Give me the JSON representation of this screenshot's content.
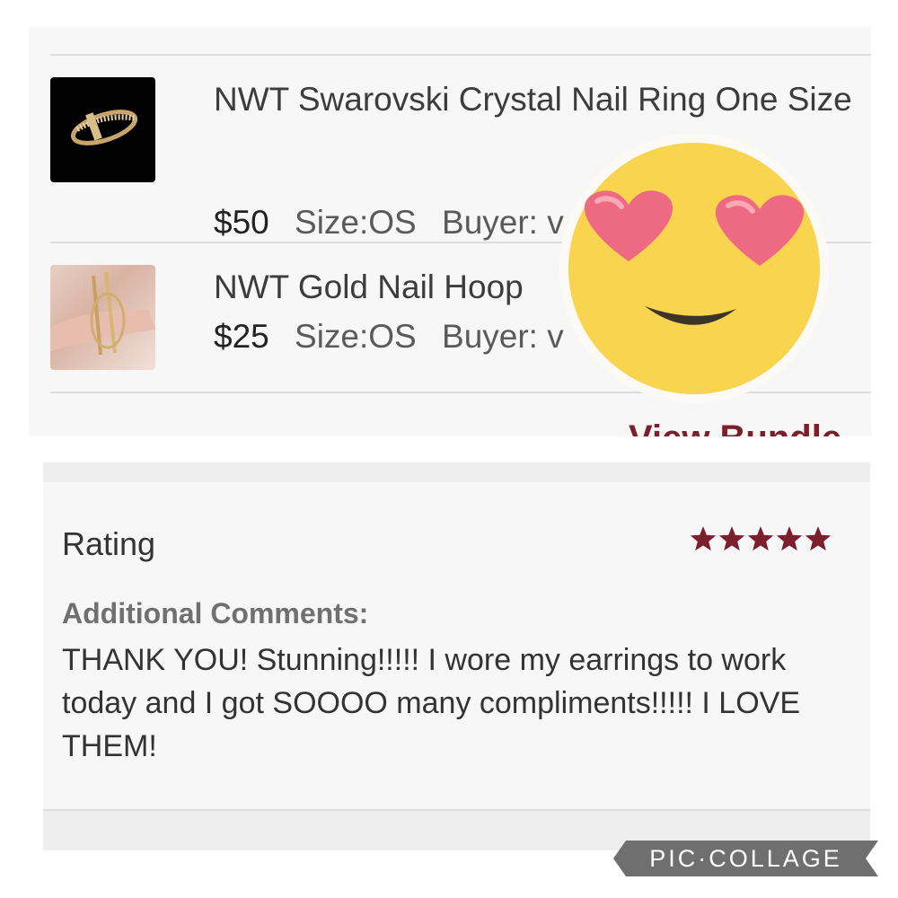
{
  "listing": {
    "items": [
      {
        "title": "NWT Swarovski Crystal Nail Ring One Size",
        "price": "$50",
        "size": "Size:OS",
        "buyer": "Buyer: v",
        "image": "crystal-nail-ring-photo"
      },
      {
        "title": "NWT Gold Nail Hoop",
        "price": "$25",
        "size": "Size:OS",
        "buyer": "Buyer: v",
        "image": "gold-nail-hoop-photo"
      }
    ],
    "view_bundle_label": "View Bundle"
  },
  "sticker": {
    "icon": "heart-eyes-emoji-icon"
  },
  "review": {
    "rating_label": "Rating",
    "stars": 5,
    "star_color": "#7d1e2b",
    "comments_label": "Additional Comments:",
    "comment_text": "THANK YOU! Stunning!!!!! I wore my earrings to work today and I got SOOOO many compliments!!!!! I LOVE THEM!"
  },
  "watermark": {
    "text": "PIC·COLLAGE"
  }
}
